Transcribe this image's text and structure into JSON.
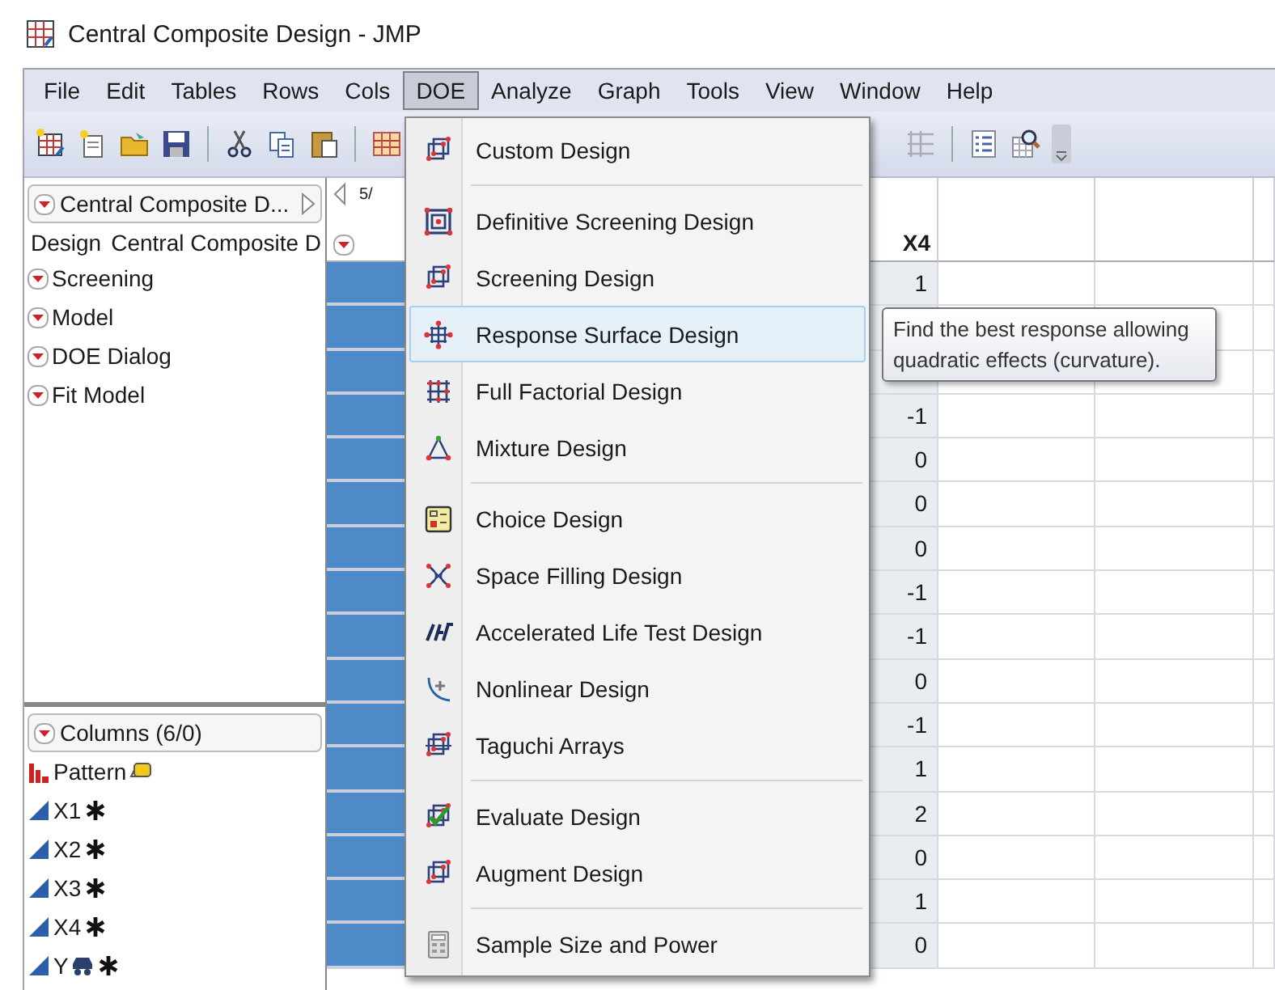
{
  "window": {
    "title": "Central Composite Design - JMP"
  },
  "menubar": [
    {
      "label": "File",
      "selected": false
    },
    {
      "label": "Edit",
      "selected": false
    },
    {
      "label": "Tables",
      "selected": false
    },
    {
      "label": "Rows",
      "selected": false
    },
    {
      "label": "Cols",
      "selected": false
    },
    {
      "label": "DOE",
      "selected": true
    },
    {
      "label": "Analyze",
      "selected": false
    },
    {
      "label": "Graph",
      "selected": false
    },
    {
      "label": "Tools",
      "selected": false
    },
    {
      "label": "View",
      "selected": false
    },
    {
      "label": "Window",
      "selected": false
    },
    {
      "label": "Help",
      "selected": false
    }
  ],
  "report_panel": {
    "header": "Central Composite D...",
    "design_label": "Design",
    "design_value": "Central Composite D",
    "scripts": [
      "Screening",
      "Model",
      "DOE Dialog",
      "Fit Model"
    ]
  },
  "columns_panel": {
    "header": "Columns (6/0)",
    "columns": [
      {
        "name": "Pattern",
        "kind": "label"
      },
      {
        "name": "X1",
        "kind": "continuous"
      },
      {
        "name": "X2",
        "kind": "continuous"
      },
      {
        "name": "X3",
        "kind": "continuous"
      },
      {
        "name": "X4",
        "kind": "continuous"
      },
      {
        "name": "Y",
        "kind": "response"
      }
    ]
  },
  "table": {
    "corner_text": "5/",
    "x4_header": "X4",
    "rows": [
      {
        "selected": true,
        "x4": "1"
      },
      {
        "selected": true
      },
      {
        "selected": true
      },
      {
        "selected": true,
        "x4": "-1"
      },
      {
        "selected": true,
        "x4": "0"
      },
      {
        "selected": true,
        "x4": "0"
      },
      {
        "selected": true,
        "x4": "0"
      },
      {
        "selected": true,
        "x4": "-1"
      },
      {
        "selected": true,
        "x4": "-1"
      },
      {
        "selected": true,
        "x4": "0"
      },
      {
        "selected": true,
        "x4": "-1"
      },
      {
        "selected": true,
        "x4": "1"
      },
      {
        "selected": true,
        "x4": "2"
      },
      {
        "selected": true,
        "x4": "0"
      },
      {
        "selected": true,
        "x4": "1"
      },
      {
        "selected": true,
        "x4": "0"
      }
    ]
  },
  "doe_menu": {
    "items": [
      {
        "kind": "item",
        "label": "Custom Design",
        "selected": false
      },
      {
        "kind": "separator"
      },
      {
        "kind": "item",
        "label": "Definitive Screening Design",
        "selected": false
      },
      {
        "kind": "item",
        "label": "Screening Design",
        "selected": false
      },
      {
        "kind": "item",
        "label": "Response Surface Design",
        "selected": true
      },
      {
        "kind": "item",
        "label": "Full Factorial Design",
        "selected": false
      },
      {
        "kind": "item",
        "label": "Mixture Design",
        "selected": false
      },
      {
        "kind": "separator"
      },
      {
        "kind": "item",
        "label": "Choice Design",
        "selected": false
      },
      {
        "kind": "item",
        "label": "Space Filling Design",
        "selected": false
      },
      {
        "kind": "item",
        "label": "Accelerated Life Test Design",
        "selected": false
      },
      {
        "kind": "item",
        "label": "Nonlinear Design",
        "selected": false
      },
      {
        "kind": "item",
        "label": "Taguchi Arrays",
        "selected": false
      },
      {
        "kind": "separator"
      },
      {
        "kind": "item",
        "label": "Evaluate Design",
        "selected": false
      },
      {
        "kind": "item",
        "label": "Augment Design",
        "selected": false
      },
      {
        "kind": "separator"
      },
      {
        "kind": "item",
        "label": "Sample Size and Power",
        "selected": false
      }
    ]
  },
  "tooltip": {
    "text": "Find the best response allowing quadratic effects (curvature)."
  }
}
